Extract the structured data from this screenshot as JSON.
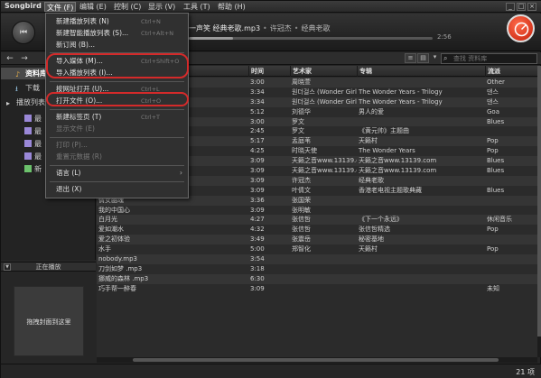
{
  "app": {
    "title": "Songbird"
  },
  "menubar": {
    "items": [
      "文件 (F)",
      "编辑 (E)",
      "控制 (C)",
      "显示 (V)",
      "工具 (T)",
      "帮助 (H)"
    ]
  },
  "player": {
    "prev_icon": "⏮",
    "track_title": "一声笑 经典老歌.mp3",
    "artist": "许冠杰",
    "album": "经典老歌",
    "time_readout": "2:56",
    "progress_fraction": 0.18
  },
  "toolbar": {
    "back_icon": "arrow-left",
    "forward_icon": "arrow-right",
    "search_placeholder": "查找 资料库"
  },
  "sidebar": {
    "items": [
      {
        "label": "资料库",
        "icon": "music-note",
        "selected": true
      },
      {
        "label": "下载",
        "icon": "download",
        "selected": false
      },
      {
        "label": "播放列表",
        "icon": "playlist",
        "selected": false
      },
      {
        "label": "最",
        "icon": "list-doc",
        "selected": false
      },
      {
        "label": "最",
        "icon": "list-doc",
        "selected": false
      },
      {
        "label": "最",
        "icon": "list-doc",
        "selected": false
      },
      {
        "label": "最",
        "icon": "list-doc",
        "selected": false
      },
      {
        "label": "新",
        "icon": "list-new",
        "selected": false
      }
    ],
    "now_playing_label": "正在播放",
    "now_playing_toggle": "▼",
    "artwork_drop_text": "拖拽封面到这里"
  },
  "file_menu": {
    "items": [
      {
        "label": "新建播放列表 (N)",
        "accel": "Ctrl+N",
        "disabled": false
      },
      {
        "label": "新建智能播放列表 (S)...",
        "accel": "Ctrl+Alt+N",
        "disabled": false
      },
      {
        "label": "新订阅 (B)...",
        "accel": "",
        "disabled": false
      },
      {
        "label": "导入媒体 (M)...",
        "accel": "Ctrl+Shift+O",
        "disabled": false
      },
      {
        "label": "导入播放列表 (I)...",
        "accel": "",
        "disabled": false
      },
      {
        "label": "按网址打开 (U)...",
        "accel": "Ctrl+L",
        "disabled": false
      },
      {
        "label": "打开文件 (O)...",
        "accel": "Ctrl+O",
        "disabled": false
      },
      {
        "label": "新建标签页 (T)",
        "accel": "Ctrl+T",
        "disabled": false
      },
      {
        "label": "显示文件 (E)",
        "accel": "",
        "disabled": true
      },
      {
        "label": "打印 (P)...",
        "accel": "",
        "disabled": true
      },
      {
        "label": "重置元数据 (R)",
        "accel": "",
        "disabled": true
      },
      {
        "label": "语言 (L)",
        "accel": "",
        "disabled": false,
        "submenu": true
      },
      {
        "label": "退出 (X)",
        "accel": "",
        "disabled": false
      }
    ],
    "highlight_color": "#d42a2a"
  },
  "table": {
    "columns": [
      "时间",
      "艺术家",
      "专辑",
      "流派"
    ],
    "rows": [
      {
        "title": "",
        "time": "3:00",
        "artist": "周晓萱",
        "album": "",
        "genre": "Other"
      },
      {
        "title": "",
        "time": "3:34",
        "artist": "원더걸스 (Wonder Girls)",
        "album": "The Wonder Years - Trilogy",
        "genre": "댄스"
      },
      {
        "title": "",
        "time": "3:34",
        "artist": "원더걸스 (Wonder Girls)",
        "album": "The Wonder Years - Trilogy",
        "genre": "댄스"
      },
      {
        "title": "",
        "time": "5:12",
        "artist": "刘德华",
        "album": "男人的爱",
        "genre": "Goa"
      },
      {
        "title": "",
        "time": "3:00",
        "artist": "罗文",
        "album": "",
        "genre": "Blues"
      },
      {
        "title": "",
        "time": "2:45",
        "artist": "罗文",
        "album": "《黄元帅》主题曲",
        "genre": ""
      },
      {
        "title": "",
        "time": "5:17",
        "artist": "孟庭苇",
        "album": "天籁村",
        "genre": "Pop"
      },
      {
        "title": "",
        "time": "4:25",
        "artist": "时晓天使",
        "album": "The Wonder Years",
        "genre": "Pop"
      },
      {
        "title": "",
        "time": "3:09",
        "artist": "天籁之音www.13139.com",
        "album": "天籁之音www.13139.com",
        "genre": "Blues"
      },
      {
        "title": "",
        "time": "3:09",
        "artist": "天籁之音www.13139.com",
        "album": "天籁之音www.13139.com",
        "genre": "Blues"
      },
      {
        "title": "",
        "time": "3:09",
        "artist": "许冠杰",
        "album": "经典老歌",
        "genre": ""
      },
      {
        "title": "",
        "time": "3:09",
        "artist": "叶倩文",
        "album": "香港老电视主题歌典藏",
        "genre": "Blues"
      },
      {
        "title": "倩女幽魂",
        "time": "3:36",
        "artist": "张国荣",
        "album": "",
        "genre": ""
      },
      {
        "title": "我的中国心",
        "time": "3:09",
        "artist": "张明敏",
        "album": "",
        "genre": ""
      },
      {
        "title": "白月光",
        "time": "4:27",
        "artist": "张信哲",
        "album": "《下一个永远》",
        "genre": "休闲音乐"
      },
      {
        "title": "爱如潮水",
        "time": "4:32",
        "artist": "张信哲",
        "album": "张信哲精选",
        "genre": "Pop"
      },
      {
        "title": "爱之初体验",
        "time": "3:49",
        "artist": "张震岳",
        "album": "秘密基地",
        "genre": ""
      },
      {
        "title": "水手",
        "time": "5:00",
        "artist": "郑智化",
        "album": "天籁村",
        "genre": "Pop"
      },
      {
        "title": "nobody.mp3",
        "time": "3:54",
        "artist": "",
        "album": "",
        "genre": ""
      },
      {
        "title": "刀剑如梦 .mp3",
        "time": "3:18",
        "artist": "",
        "album": "",
        "genre": ""
      },
      {
        "title": "挪威的森林 .mp3",
        "time": "6:30",
        "artist": "",
        "album": "",
        "genre": ""
      },
      {
        "title": "巧手帮一醉春",
        "time": "3:09",
        "artist": "",
        "album": "",
        "genre": "未知"
      }
    ]
  },
  "status": {
    "count": "21 项"
  }
}
